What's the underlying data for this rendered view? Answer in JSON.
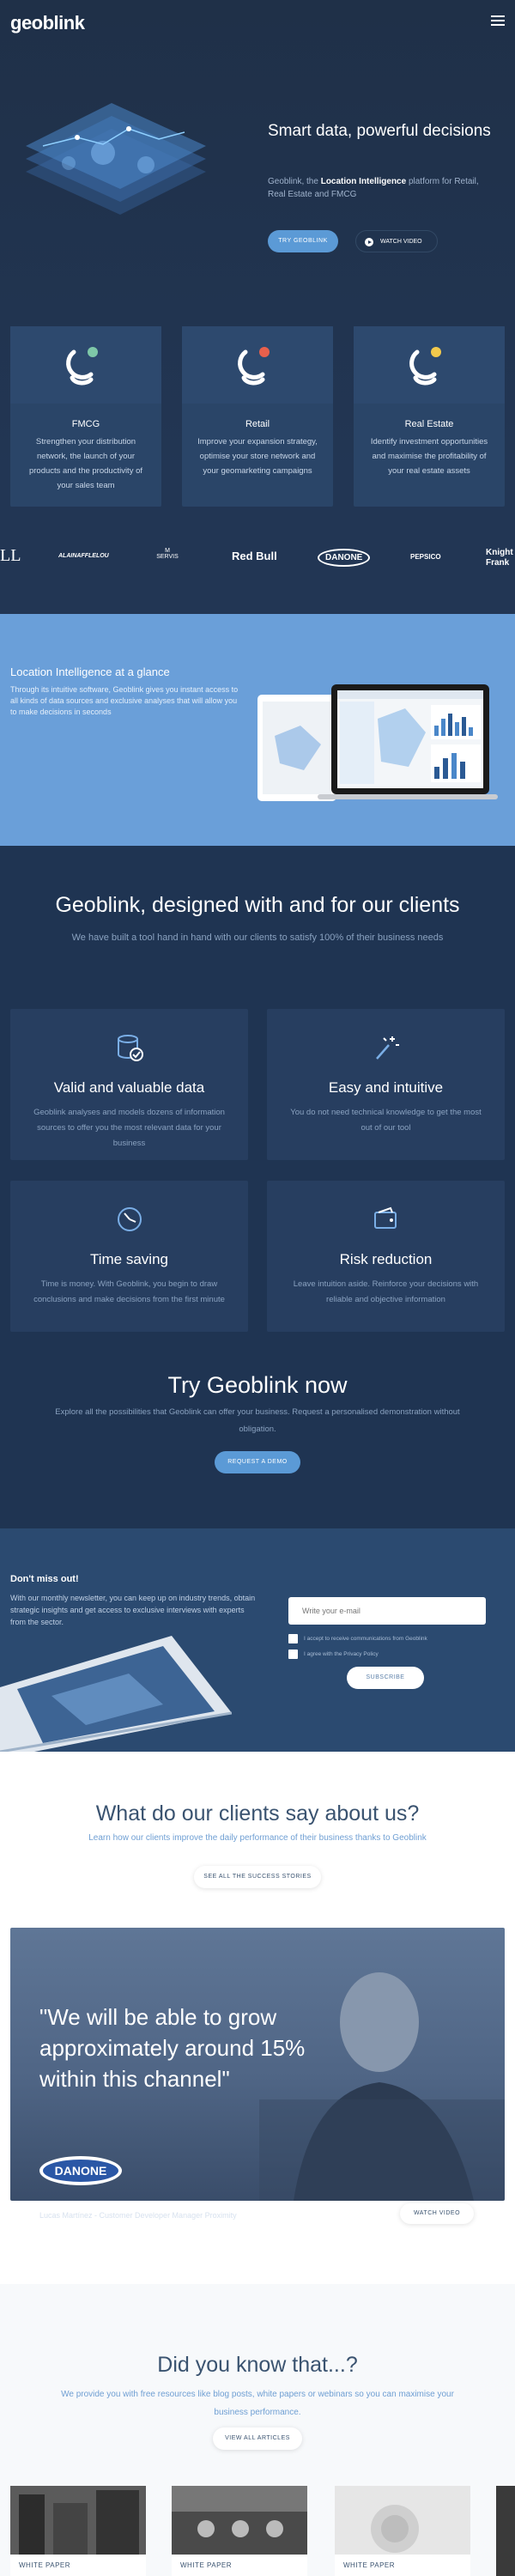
{
  "header": {
    "logo": "geoblink",
    "menu_icon": "hamburger-icon"
  },
  "hero": {
    "title": "Smart data, powerful decisions",
    "desc_prefix": "Geoblink, the ",
    "desc_bold": "Location Intelligence",
    "desc_suffix": " platform for Retail, Real Estate and FMCG",
    "cta_primary": "TRY GEOBLINK",
    "cta_video": "WATCH VIDEO"
  },
  "sectors": [
    {
      "title": "FMCG",
      "desc": "Strengthen your distribution network, the launch of your products and the productivity of your sales team",
      "pin_color": "#7ec8a8"
    },
    {
      "title": "Retail",
      "desc": "Improve your expansion strategy, optimise your store network and your geomarketing campaigns",
      "pin_color": "#e8604c"
    },
    {
      "title": "Real Estate",
      "desc": "Identify investment opportunities and maximise the profitability of your real estate assets",
      "pin_color": "#f2c94c"
    }
  ],
  "logos": [
    "LL",
    "ALAINAFFLELOU",
    "M SERVIS",
    "Red Bull",
    "DANONE",
    "PEPSICO",
    "Knight Frank"
  ],
  "li": {
    "title": "Location Intelligence at a glance",
    "desc": "Through its intuitive software, Geoblink gives you instant access to all kinds of data sources and exclusive analyses that will allow you to make decisions in seconds"
  },
  "clients": {
    "title": "Geoblink, designed with and for our clients",
    "subtitle": "We have built a tool hand in hand with our clients to satisfy 100% of their business needs",
    "features": [
      {
        "title": "Valid and valuable data",
        "desc": "Geoblink analyses and models dozens of information sources to offer you the most relevant data for your business",
        "icon": "database-check-icon"
      },
      {
        "title": "Easy and intuitive",
        "desc": "You do not need technical knowledge to get the most out of our tool",
        "icon": "magic-wand-icon"
      },
      {
        "title": "Time saving",
        "desc": "Time is money. With Geoblink, you begin to draw conclusions and make decisions from the first minute",
        "icon": "clock-icon"
      },
      {
        "title": "Risk reduction",
        "desc": "Leave intuition aside. Reinforce your decisions with reliable and objective information",
        "icon": "wallet-icon"
      }
    ],
    "try_title": "Try Geoblink now",
    "try_sub": "Explore all the possibilities that Geoblink can offer your business. Request a personalised demonstration without obligation.",
    "try_cta": "REQUEST A DEMO"
  },
  "newsletter": {
    "title": "Don't miss out!",
    "desc": "With our monthly newsletter, you can keep up on industry trends, obtain strategic insights and get access to exclusive interviews with experts from the sector.",
    "email_placeholder": "Write your e-mail",
    "check1": "I accept to receive communications from Geoblink",
    "check2": "I agree with the Privacy Policy",
    "subscribe": "SUBSCRIBE"
  },
  "testimonials": {
    "title": "What do our clients say about us?",
    "subtitle": "Learn how our clients improve the daily performance of their business thanks to Geoblink",
    "cta": "SEE ALL THE SUCCESS STORIES",
    "quote": "\"We will be able to grow approximately around 15% within this channel\"",
    "brand": "DANONE",
    "person": "Lucas Martínez - Customer Developer Manager Proximity",
    "video_cta": "WATCH VIDEO"
  },
  "resources": {
    "title": "Did you know that...?",
    "subtitle": "We provide you with free resources like blog posts, white papers or webinars so you can maximise your business performance.",
    "cta": "VIEW ALL ARTICLES",
    "cards": [
      {
        "tag": "WHITE PAPER"
      },
      {
        "tag": "WHITE PAPER"
      },
      {
        "tag": "WHITE PAPER"
      }
    ]
  }
}
